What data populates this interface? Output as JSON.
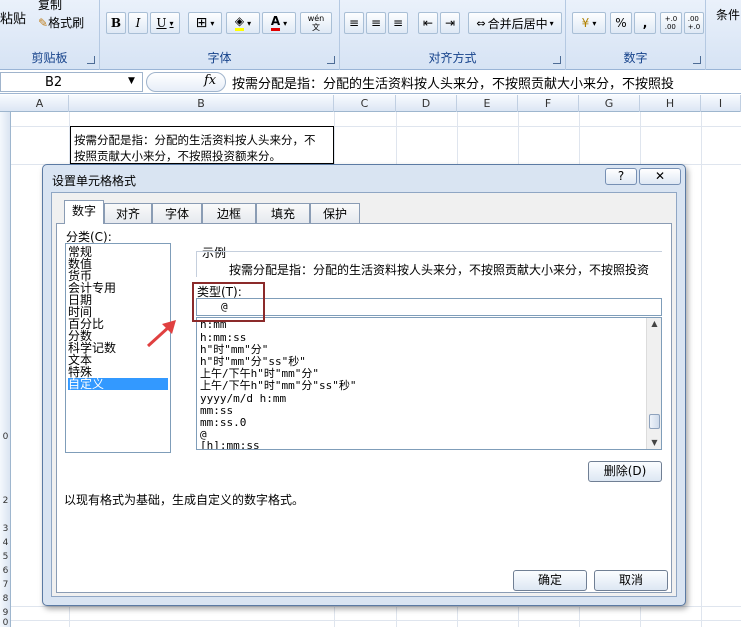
{
  "ribbon": {
    "paste_label": "粘贴",
    "copy_label": "复制",
    "format_painter_label": "格式刷",
    "clipboard_group": "剪贴板",
    "font_group": "字体",
    "alignment_group": "对齐方式",
    "number_group": "数字",
    "merge_center_label": "合并后居中",
    "conditional_label": "条件",
    "bold": "B",
    "italic": "I",
    "underline": "U",
    "font_color_letter": "A",
    "wen_label": "wén\n文",
    "percent": "%",
    "comma": ",",
    "inc_decimal": "+.0\n.00",
    "dec_decimal": ".00\n+.0"
  },
  "formula_bar": {
    "name_box": "B2",
    "fx": "fx",
    "content": "按需分配是指：分配的生活资料按人头来分，不按照贡献大小来分，不按照投"
  },
  "sheet": {
    "columns": [
      "A",
      "B",
      "C",
      "D",
      "E",
      "F",
      "G",
      "H",
      "I"
    ],
    "row_numbers": [
      "0",
      "2",
      "3",
      "4",
      "5",
      "6",
      "7",
      "8",
      "9",
      "0"
    ],
    "cell_b2_line1": "按需分配是指：分配的生活资料按人头来分，不",
    "cell_b2_line2": "按照贡献大小来分，不按照投资额来分。"
  },
  "dialog": {
    "title": "设置单元格格式",
    "help_btn": "?",
    "close_btn": "✕",
    "tabs": [
      "数字",
      "对齐",
      "字体",
      "边框",
      "填充",
      "保护"
    ],
    "category_label": "分类(C):",
    "categories": [
      "常规",
      "数值",
      "货币",
      "会计专用",
      "日期",
      "时间",
      "百分比",
      "分数",
      "科学记数",
      "文本",
      "特殊",
      "自定义"
    ],
    "selected_category": "自定义",
    "sample_label": "示例",
    "sample_value": "按需分配是指：分配的生活资料按人头来分，不按照贡献大小来分，不按照投资",
    "type_label": "类型(T):",
    "type_value": "@",
    "format_list": [
      "h:mm",
      "h:mm:ss",
      "h\"时\"mm\"分\"",
      "h\"时\"mm\"分\"ss\"秒\"",
      "上午/下午h\"时\"mm\"分\"",
      "上午/下午h\"时\"mm\"分\"ss\"秒\"",
      "yyyy/m/d h:mm",
      "mm:ss",
      "mm:ss.0",
      "@",
      "[h]:mm:ss"
    ],
    "delete_btn": "删除(D)",
    "description": "以现有格式为基础，生成自定义的数字格式。",
    "ok_btn": "确定",
    "cancel_btn": "取消"
  },
  "colors": {
    "selection": "#3399ff",
    "highlight_box": "#8b2a2a",
    "arrow": "#e04040"
  }
}
